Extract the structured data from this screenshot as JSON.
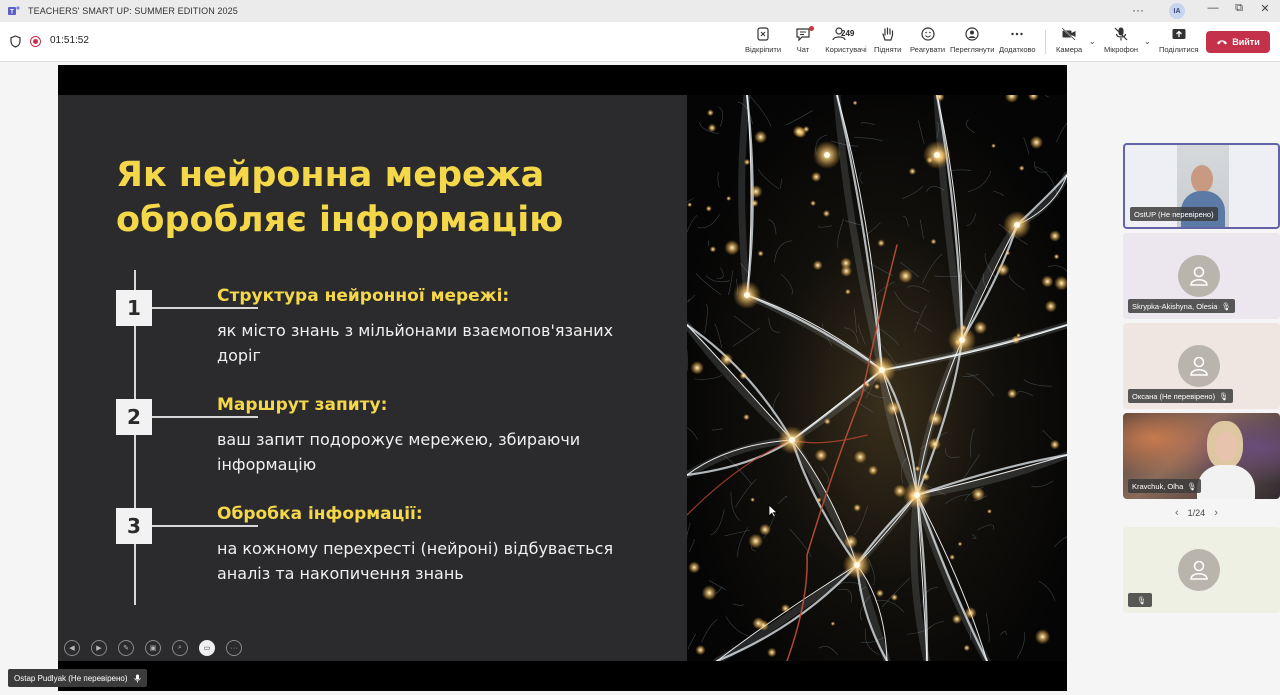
{
  "window": {
    "title": "TEACHERS' SMART UP: SUMMER EDITION 2025",
    "more": "···",
    "user_initials": "IA",
    "minimize": "—",
    "restore": "⧉",
    "close": "✕"
  },
  "meeting": {
    "timer": "01:51:52",
    "toolbar": {
      "unpin": "Відкріпити",
      "chat": "Чат",
      "people": "Користувачі",
      "people_count": "249",
      "raise": "Підняти",
      "react": "Реагувати",
      "view": "Переглянути",
      "more": "Додатково",
      "camera": "Камера",
      "mic": "Мікрофон",
      "share": "Поділитися",
      "leave": "Вийти"
    }
  },
  "slide": {
    "title": "Як нейронна мережа обробляє інформацію",
    "steps": [
      {
        "num": "1",
        "heading": "Структура нейронної мережі:",
        "body": "як місто знань з мільйонами взаємопов'язаних доріг"
      },
      {
        "num": "2",
        "heading": "Маршрут запиту:",
        "body": "ваш запит подорожує мережею, збираючи інформацію"
      },
      {
        "num": "3",
        "heading": "Обробка інформації:",
        "body": "на кожному перехресті (нейроні) відбувається аналіз та накопичення знань"
      }
    ]
  },
  "presenter": {
    "name": "Ostap Pudlyak (Не перевірено)"
  },
  "participants": [
    {
      "name": "OstUP (Не перевірено)"
    },
    {
      "name": "Skrypka-Akishyna, Olesia"
    },
    {
      "name": "Оксана (Не перевірено)"
    },
    {
      "name": "Kravchuk, Olha"
    },
    {
      "name": ""
    }
  ],
  "pager": {
    "label": "1/24"
  },
  "colors": {
    "accent": "#f5d84a",
    "leave": "#c4314b",
    "slide_bg": "#2b2b2d",
    "active_border": "#6264a7"
  }
}
